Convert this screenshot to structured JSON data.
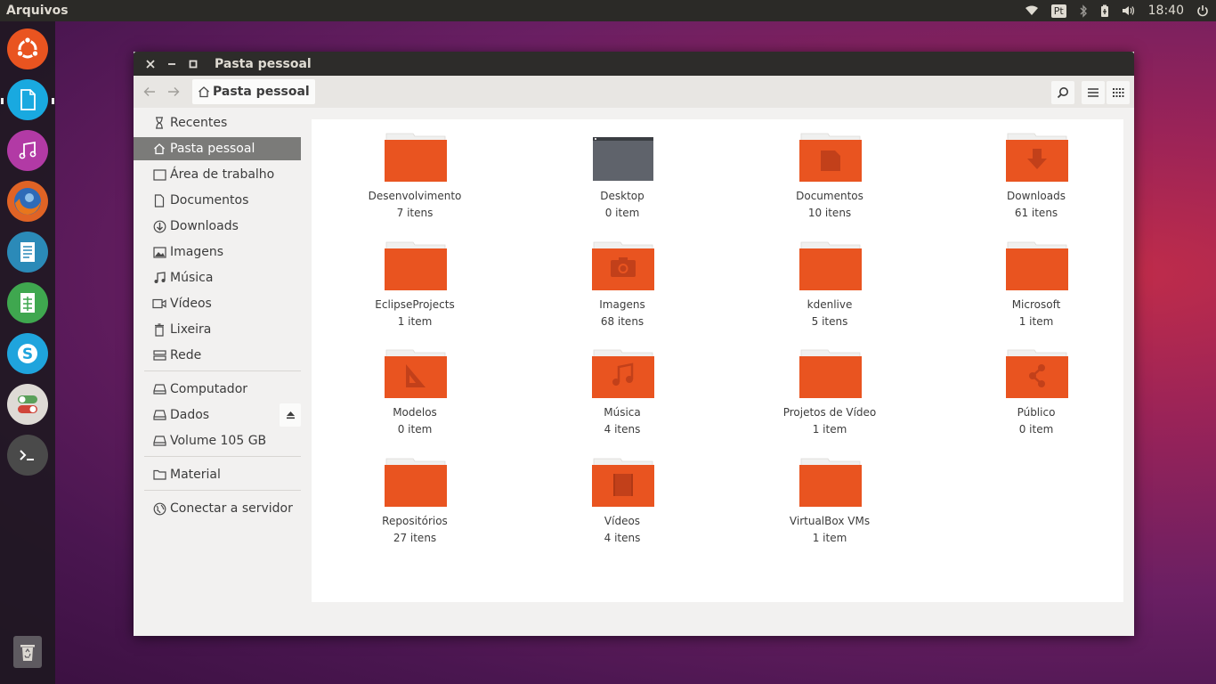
{
  "top_panel": {
    "app_name": "Arquivos",
    "keyboard_layout": "Pt",
    "clock": "18:40"
  },
  "launcher": {
    "items": [
      {
        "name": "ubuntu-dash-icon",
        "color": "#e95420"
      },
      {
        "name": "files-app-icon",
        "color": "#19a9e0"
      },
      {
        "name": "music-app-icon",
        "color": "#b23aa5"
      },
      {
        "name": "firefox-icon",
        "color": "#e06325"
      },
      {
        "name": "writer-icon",
        "color": "#2b8ab8"
      },
      {
        "name": "calc-icon",
        "color": "#3fa74f"
      },
      {
        "name": "skype-icon",
        "color": "#1fa4dd"
      },
      {
        "name": "settings-toggle-icon",
        "color": "#dedad5"
      },
      {
        "name": "terminal-icon",
        "color": "#4a4a4a"
      }
    ],
    "trash_icon": "trash-icon"
  },
  "window": {
    "title": "Pasta pessoal",
    "path_label": "Pasta pessoal"
  },
  "sidebar": {
    "places": [
      {
        "label": "Recentes",
        "icon": "clock-icon"
      },
      {
        "label": "Pasta pessoal",
        "icon": "home-icon",
        "selected": true
      },
      {
        "label": "Área de trabalho",
        "icon": "desktop-icon"
      },
      {
        "label": "Documentos",
        "icon": "document-icon"
      },
      {
        "label": "Downloads",
        "icon": "download-icon"
      },
      {
        "label": "Imagens",
        "icon": "image-icon"
      },
      {
        "label": "Música",
        "icon": "music-icon"
      },
      {
        "label": "Vídeos",
        "icon": "video-icon"
      },
      {
        "label": "Lixeira",
        "icon": "trash-icon"
      },
      {
        "label": "Rede",
        "icon": "network-icon"
      }
    ],
    "devices": [
      {
        "label": "Computador",
        "icon": "drive-icon"
      },
      {
        "label": "Dados",
        "icon": "drive-icon"
      },
      {
        "label": "Volume 105 GB",
        "icon": "drive-icon"
      }
    ],
    "bookmarks": [
      {
        "label": "Material",
        "icon": "folder-icon"
      }
    ],
    "connect": {
      "label": "Conectar a servidor",
      "icon": "globe-icon"
    }
  },
  "files": [
    {
      "name": "Desenvolvimento",
      "count": "7 itens",
      "emblem": "none"
    },
    {
      "name": "Desktop",
      "count": "0 item",
      "emblem": "desktop"
    },
    {
      "name": "Documentos",
      "count": "10 itens",
      "emblem": "document"
    },
    {
      "name": "Downloads",
      "count": "61 itens",
      "emblem": "download"
    },
    {
      "name": "EclipseProjects",
      "count": "1 item",
      "emblem": "none"
    },
    {
      "name": "Imagens",
      "count": "68 itens",
      "emblem": "camera"
    },
    {
      "name": "kdenlive",
      "count": "5 itens",
      "emblem": "none"
    },
    {
      "name": "Microsoft",
      "count": "1 item",
      "emblem": "none"
    },
    {
      "name": "Modelos",
      "count": "0 item",
      "emblem": "template"
    },
    {
      "name": "Música",
      "count": "4 itens",
      "emblem": "music"
    },
    {
      "name": "Projetos de Vídeo",
      "count": "1 item",
      "emblem": "none"
    },
    {
      "name": "Público",
      "count": "0 item",
      "emblem": "share"
    },
    {
      "name": "Repositórios",
      "count": "27 itens",
      "emblem": "none"
    },
    {
      "name": "Vídeos",
      "count": "4 itens",
      "emblem": "film"
    },
    {
      "name": "VirtualBox VMs",
      "count": "1 item",
      "emblem": "none"
    }
  ],
  "colors": {
    "folder": "#e95420",
    "folder_tab": "#f0f0ef",
    "emblem": "#c2401a",
    "selected_bg": "#7b7b79"
  }
}
